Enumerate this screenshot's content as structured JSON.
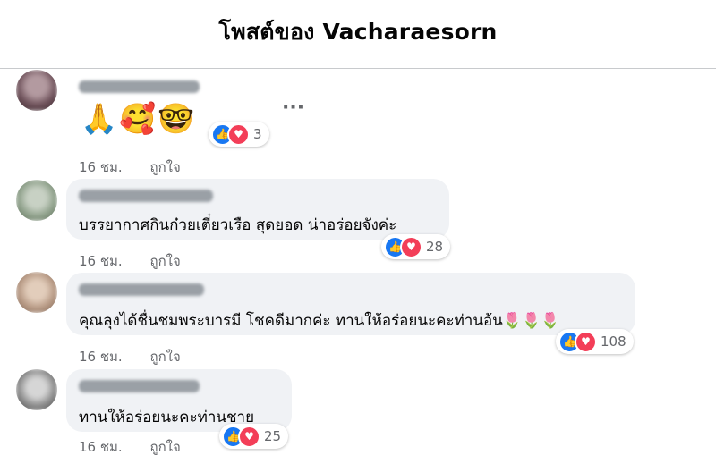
{
  "header": {
    "title": "โพสต์ของ Vacharaesorn"
  },
  "comments": [
    {
      "text": "🙏🥰🤓",
      "reaction_count": "3",
      "time": "16 ชม.",
      "like_label": "ถูกใจ",
      "more_icon": "more-options-icon"
    },
    {
      "text": "บรรยากาศกินก๋วยเตี๋ยวเรือ สุดยอด น่าอร่อยจังค่ะ",
      "reaction_count": "28",
      "time": "16 ชม.",
      "like_label": "ถูกใจ"
    },
    {
      "text": "คุณลุงได้ชื่นชมพระบารมี โชคดีมากค่ะ ทานให้อร่อยนะคะท่านอ้น",
      "text_emoji": "🌷🌷🌷",
      "reaction_count": "108",
      "time": "16 ชม.",
      "like_label": "ถูกใจ"
    },
    {
      "text": "ทานให้อร่อยนะคะท่านชาย",
      "reaction_count": "25",
      "time": "16 ชม.",
      "like_label": "ถูกใจ"
    }
  ],
  "icons": {
    "like": "thumbs-up-icon",
    "love": "heart-icon"
  },
  "colors": {
    "like": "#1877f2",
    "love": "#f33e58",
    "bubble": "#f0f2f5",
    "meta": "#65676b"
  }
}
